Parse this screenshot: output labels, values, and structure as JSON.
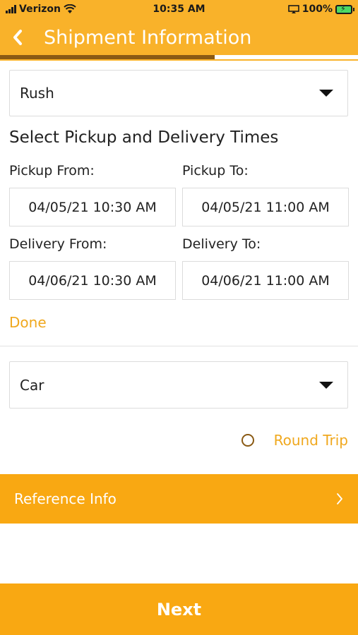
{
  "status_bar": {
    "carrier": "Verizon",
    "time": "10:35 AM",
    "battery": "100%",
    "icons": [
      "signal-icon",
      "wifi-icon",
      "screen-mirroring-icon",
      "battery-charging-icon"
    ]
  },
  "header": {
    "title": "Shipment Information",
    "back_icon": "chevron-left-icon",
    "progress": 0.6
  },
  "service_select": {
    "value": "Rush",
    "icon": "caret-down-icon"
  },
  "times": {
    "section_title": "Select Pickup and Delivery Times",
    "pickup_from_label": "Pickup From:",
    "pickup_to_label": "Pickup To:",
    "pickup_from_value": "04/05/21 10:30 AM",
    "pickup_to_value": "04/05/21 11:00 AM",
    "delivery_from_label": "Delivery From:",
    "delivery_to_label": "Delivery To:",
    "delivery_from_value": "04/06/21 10:30 AM",
    "delivery_to_value": "04/06/21 11:00 AM",
    "done_label": "Done"
  },
  "vehicle_select": {
    "value": "Car",
    "icon": "caret-down-icon"
  },
  "round_trip": {
    "label": "Round Trip",
    "checked": false
  },
  "reference": {
    "label": "Reference Info",
    "icon": "chevron-right-icon"
  },
  "footer": {
    "next_label": "Next"
  },
  "colors": {
    "accent": "#f9a812",
    "header": "#f9b22a",
    "progress": "#8a5a14",
    "link": "#f0a81e"
  }
}
